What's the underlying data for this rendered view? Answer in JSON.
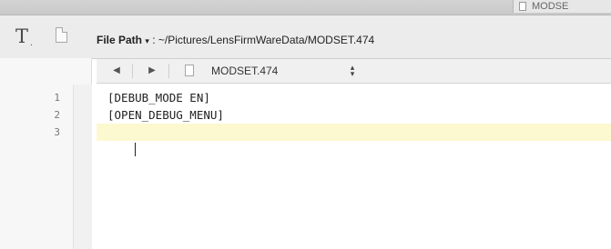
{
  "window": {
    "tab_fragment": "MODSE"
  },
  "toolbar": {
    "text_tool_icon": "text-format-icon",
    "text_tool_glyph": "T",
    "text_tool_sub": ".",
    "document_icon": "document-icon",
    "file_path_label": "File Path",
    "file_path_caret": "▾",
    "file_path_separator": " : ",
    "file_path_value": "~/Pictures/LensFirmWareData/MODSET.474"
  },
  "navigation": {
    "back_glyph": "◀",
    "forward_glyph": "▶",
    "filename": "MODSET.474",
    "stepper_glyph_up": "▴",
    "stepper_glyph_down": "▾"
  },
  "editor": {
    "line_numbers": [
      "1",
      "2",
      "3"
    ],
    "lines": [
      "[DEBUB_MODE EN]",
      "[OPEN_DEBUG_MENU]",
      ""
    ],
    "current_line_index": 2,
    "current_line_color": "#fcf8cf"
  }
}
